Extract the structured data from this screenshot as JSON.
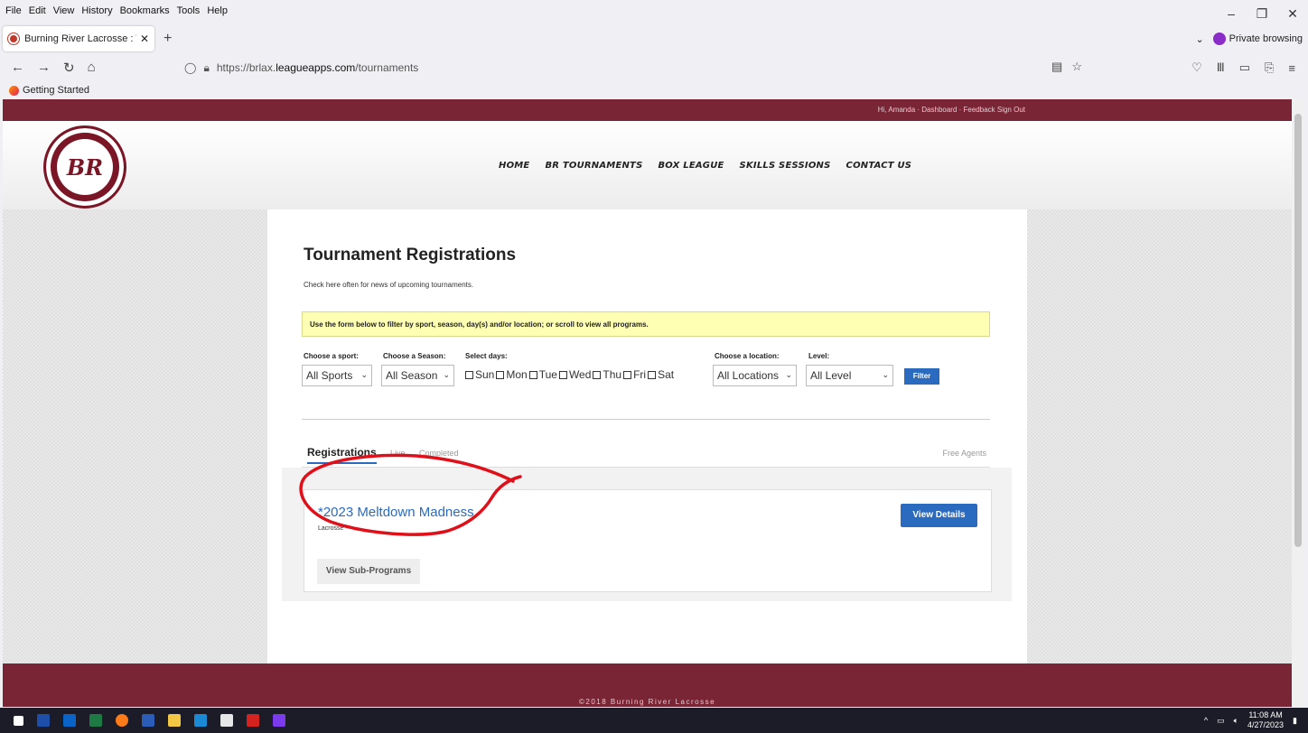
{
  "browser": {
    "menus": [
      "File",
      "Edit",
      "View",
      "History",
      "Bookmarks",
      "Tools",
      "Help"
    ],
    "tab_title": "Burning River Lacrosse : Tourna",
    "private_label": "Private browsing",
    "url_prefix": "https://brlax.",
    "url_domain": "leagueapps.com",
    "url_path": "/tournaments",
    "bookmark": "Getting Started"
  },
  "site": {
    "top_links": "Hi, Amanda · Dashboard · Feedback  Sign Out",
    "logo_text": "BR",
    "nav": [
      "HOME",
      "BR TOURNAMENTS",
      "BOX LEAGUE",
      "SKILLS SESSIONS",
      "CONTACT US"
    ],
    "footer": "©2018 Burning River Lacrosse"
  },
  "page": {
    "title": "Tournament Registrations",
    "subtitle": "Check here often for news of upcoming tournaments.",
    "notice": "Use the form below to filter by sport, season, day(s) and/or location; or scroll to view all programs."
  },
  "filters": {
    "sport_label": "Choose a sport:",
    "sport_value": "All Sports",
    "season_label": "Choose a Season:",
    "season_value": "All Season",
    "days_label": "Select days:",
    "days": [
      "Sun",
      "Mon",
      "Tue",
      "Wed",
      "Thu",
      "Fri",
      "Sat"
    ],
    "location_label": "Choose a location:",
    "location_value": "All Locations",
    "level_label": "Level:",
    "level_value": "All Level",
    "filter_button": "Filter"
  },
  "tabs": {
    "registrations": "Registrations",
    "live": "Live",
    "completed": "Completed",
    "free_agents": "Free Agents"
  },
  "program": {
    "name": "*2023 Meltdown Madness",
    "sport": "Lacrosse",
    "view_details": "View Details",
    "view_sub": "View Sub-Programs"
  },
  "taskbar": {
    "time": "11:08 AM",
    "date": "4/27/2023"
  },
  "colors": {
    "brand": "#7a2535",
    "button": "#2b6bbf",
    "notice": "#ffffb3",
    "annotation": "#e0101a"
  }
}
